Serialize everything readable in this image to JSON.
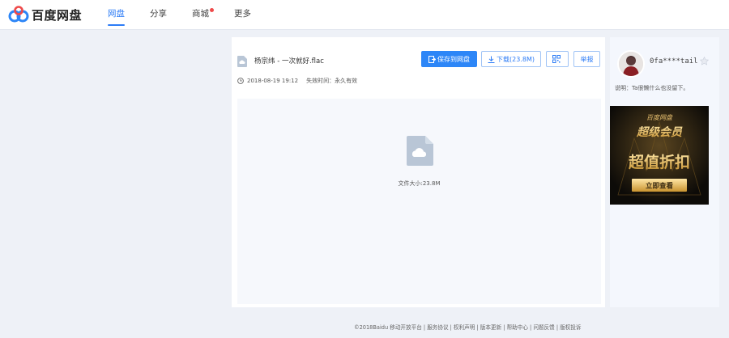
{
  "header": {
    "logo_text": "百度网盘",
    "nav": [
      {
        "label": "网盘"
      },
      {
        "label": "分享"
      },
      {
        "label": "商城"
      },
      {
        "label": "更多"
      }
    ]
  },
  "share": {
    "file_name": "杨宗纬 - 一次就好.flac",
    "save_button": "保存到网盘",
    "download_button": "下载(23.8M)",
    "report_button": "举报",
    "date": "2018-08-19 19:12",
    "expire": "失效时间：永久有效",
    "file_size": "文件大小:23.8M"
  },
  "sidebar": {
    "username": "0fa****tail",
    "description": "说明：Ta很懒什么也没留下。",
    "ad": {
      "brand": "百度网盘",
      "headline": "超级会员",
      "tagline": "超值折扣",
      "cta": "立即查看"
    }
  },
  "footer": {
    "text": "©2018Baidu 移动开放平台 | 服务协议 | 权利声明 | 版本更新 | 帮助中心 | 问题反馈 | 版权投诉"
  },
  "colors": {
    "accent": "#2d86f7",
    "background": "#eef1f7",
    "badge": "#ef4a4a",
    "ad_gold": "#e8c070"
  }
}
